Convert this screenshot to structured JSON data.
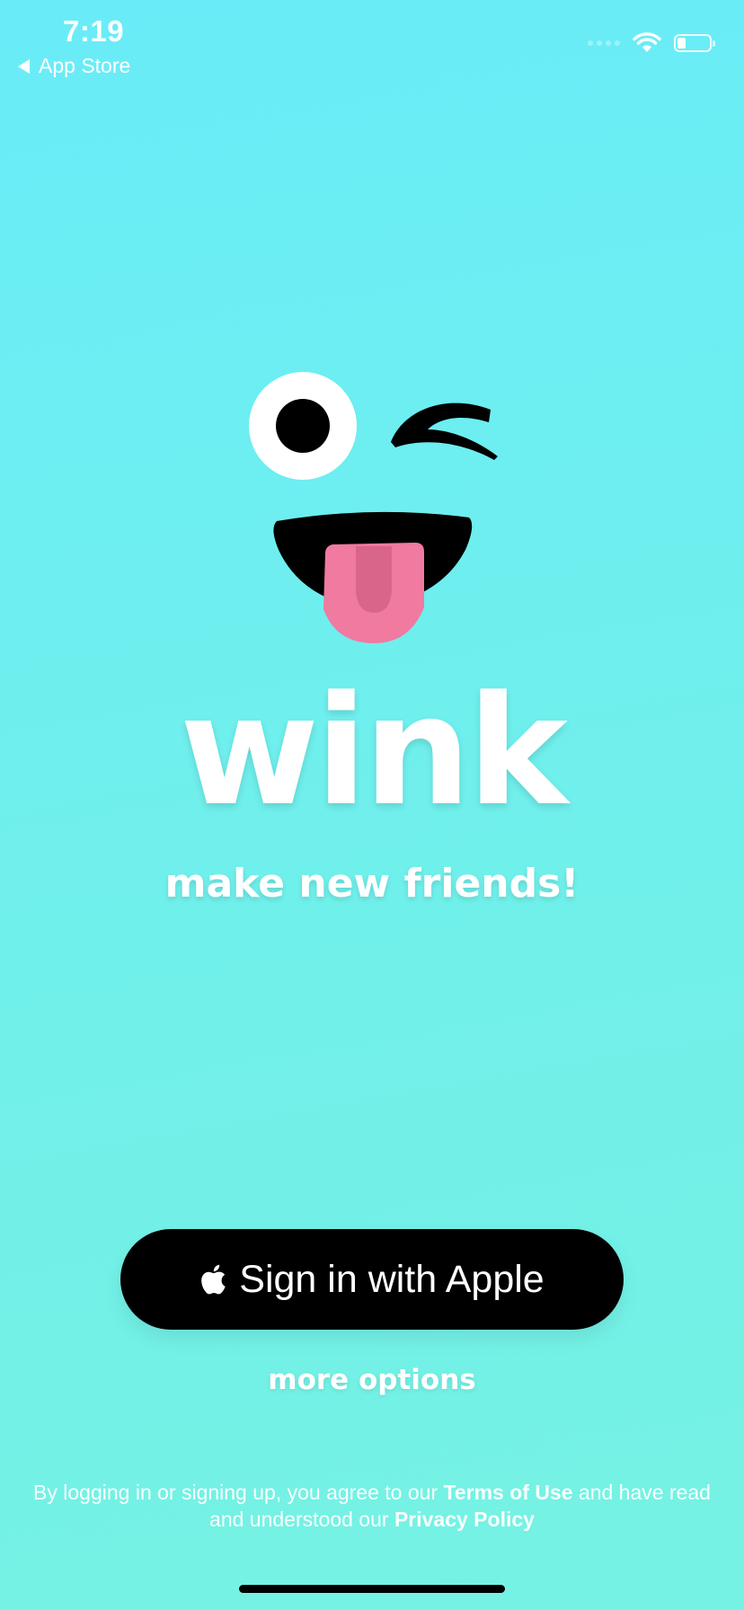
{
  "status_bar": {
    "time": "7:19",
    "back_app_label": "App Store",
    "battery_level_fraction": 0.25
  },
  "brand": {
    "name": "wink",
    "tagline": "make new friends!",
    "logo_icon": "winking-face-tongue-icon"
  },
  "actions": {
    "apple_signin_label": "Sign in with Apple",
    "apple_icon": "apple-logo-icon",
    "more_options_label": "more options"
  },
  "legal": {
    "prefix": "By logging in or signing up, you agree to our ",
    "terms_label": "Terms of Use",
    "middle": " and have read and understood our ",
    "privacy_label": "Privacy Policy"
  },
  "colors": {
    "background_top": "#69ecf8",
    "background_bottom": "#76f2e2",
    "tongue": "#f07aa0",
    "button": "#000000"
  }
}
